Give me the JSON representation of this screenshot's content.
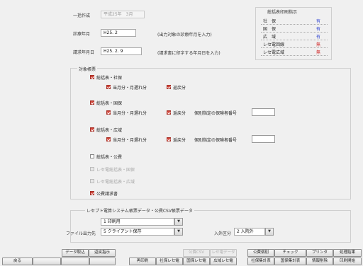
{
  "header": {
    "ichikubo_label": "一括作成",
    "ichikubo_value": "平成25年　3月",
    "shinryo_label": "診療年月",
    "shinryo_value": "H25. 2",
    "shinryo_hint": "(出力対象の診療年月を入力)",
    "seikyu_label": "請求年月日",
    "seikyu_value": "H25. 2. 9",
    "seikyu_hint": "(請求書に印字する年月日を入力)"
  },
  "legend": {
    "title": "総括表印刷指示",
    "rows": [
      {
        "label": "社　保",
        "mark": "有",
        "color": "#2a3fd0"
      },
      {
        "label": "国　保",
        "mark": "有",
        "color": "#2a3fd0"
      },
      {
        "label": "広　域",
        "mark": "有",
        "color": "#2a3fd0"
      },
      {
        "label": "レセ電回線",
        "mark": "無",
        "color": "#d02a2a"
      },
      {
        "label": "レセ電広域",
        "mark": "無",
        "color": "#d02a2a"
      }
    ]
  },
  "target": {
    "section_label": "対象帳票",
    "shaho": "総括表・社保",
    "shaho_current": "当月分・月遅れ分",
    "shaho_return": "返戻分",
    "kokuho": "総括表・国保",
    "kokuho_current": "当月分・月遅れ分",
    "kokuho_return": "返戻分",
    "kokuho_insurer": "個別指定の保険者番号",
    "koiki": "総括表・広域",
    "koiki_current": "当月分・月遅れ分",
    "koiki_return": "返戻分",
    "koiki_insurer": "個別指定の保険者番号",
    "kohi": "総括表・公費",
    "resep_kokuho": "レセ電総括表・国保",
    "resep_koiki": "レセ電総括表・広域",
    "kohi_seikyu": "公費請求書"
  },
  "output": {
    "section_label": "レセプト電算システム帳票データ・公費CSV帳票データ",
    "select1_value": "1 印刷用",
    "file_label": "ファイル出力先",
    "file_value": "5 クライアント保存",
    "nyugai_label": "入外区分",
    "nyugai_value": "2 入院外"
  },
  "buttons": {
    "row1": {
      "data_in": "データ取込",
      "henrei": "返戻指示",
      "kohi_csv": "公費CSV",
      "disabled2": "レセ電データ",
      "kohi_betsu": "公費個別",
      "check": "チェック",
      "printer": "プリンタ",
      "result": "処理結果"
    },
    "row2": {
      "back": "戻る",
      "reprint": "再印刷",
      "shaho_resep": "社保レセ電",
      "kokuho_resep": "国保レセ電",
      "koiki_resep": "広域レセ電",
      "shaho_shukei": "社保集計表",
      "kokuho_shukei": "国保集計表",
      "info_delete": "情報削除",
      "print_start": "印刷開始"
    }
  }
}
